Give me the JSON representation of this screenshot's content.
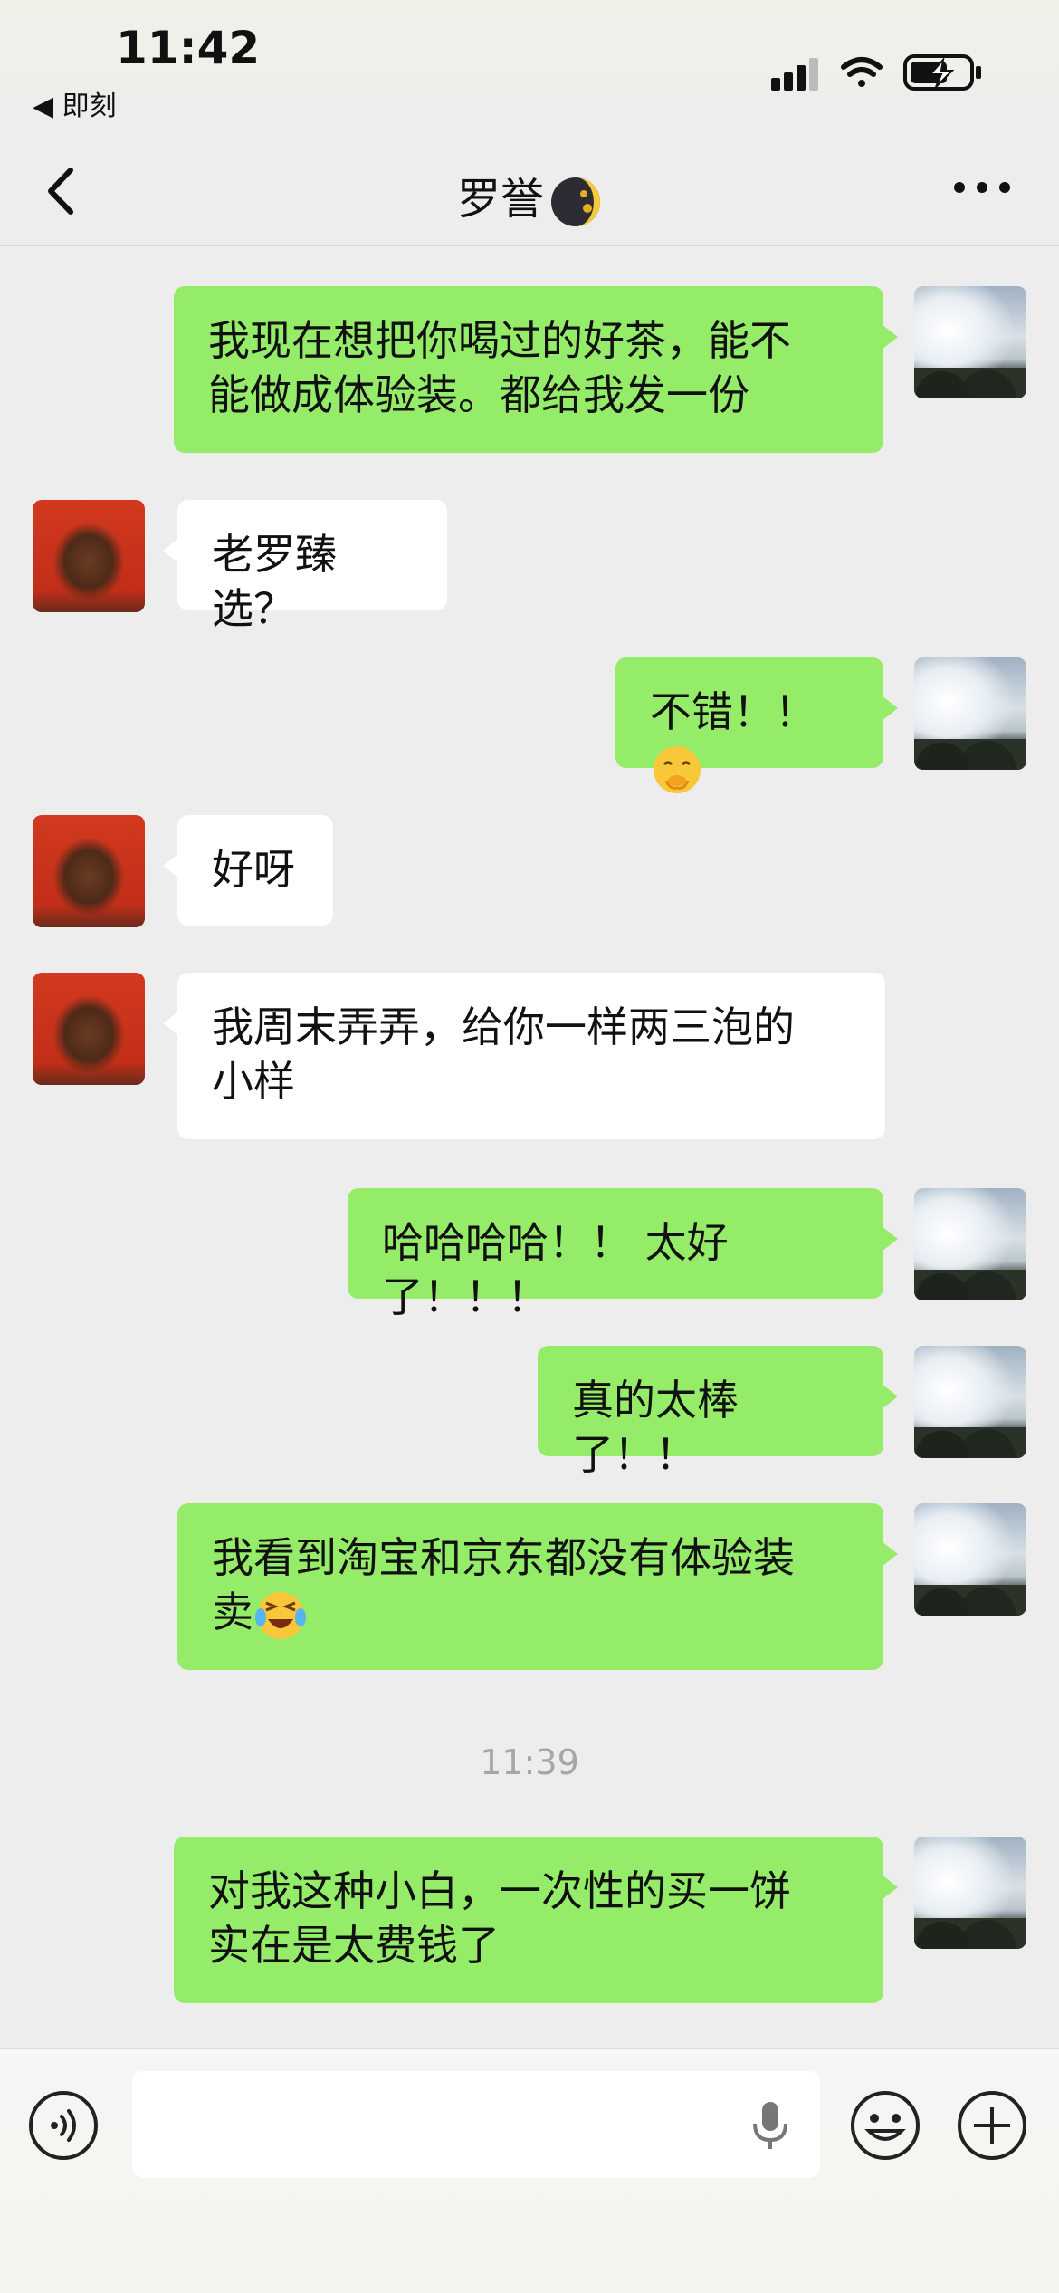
{
  "status_bar": {
    "time": "11:42",
    "back_app": "◀ 即刻"
  },
  "header": {
    "title": "罗誉",
    "title_emoji": "moon-emoji"
  },
  "messages": [
    {
      "side": "right",
      "avatar": "sky-photo",
      "text": "我现在想把你喝过的好茶，能不\n能做成体验装。都给我发一份"
    },
    {
      "side": "left",
      "avatar": "person-photo",
      "text": "老罗臻选？"
    },
    {
      "side": "right",
      "avatar": "sky-photo",
      "text": "不错！！",
      "emoji": "shy-face-emoji"
    },
    {
      "side": "left",
      "avatar": "person-photo",
      "text": "好呀"
    },
    {
      "side": "left",
      "avatar": "person-photo",
      "text": "我周末弄弄，给你一样两三泡的\n小样"
    },
    {
      "side": "right",
      "avatar": "sky-photo",
      "text": "哈哈哈哈！！ 太好了！！！"
    },
    {
      "side": "right",
      "avatar": "sky-photo",
      "text": "真的太棒了！！"
    },
    {
      "side": "right",
      "avatar": "sky-photo",
      "text": "我看到淘宝和京东都没有体验装\n卖",
      "emoji": "laugh-cry-emoji"
    },
    {
      "timestamp": "11:39"
    },
    {
      "side": "right",
      "avatar": "sky-photo",
      "text": "对我这种小白，一次性的买一饼\n实在是太费钱了"
    }
  ],
  "input_bar": {
    "voice_icon": "voice-icon",
    "mic_icon": "microphone-icon",
    "emoji_icon": "emoji-icon",
    "plus_icon": "plus-icon",
    "value": ""
  },
  "colors": {
    "outgoing_bubble": "#95ec69",
    "incoming_bubble": "#ffffff",
    "background": "#ededed"
  }
}
